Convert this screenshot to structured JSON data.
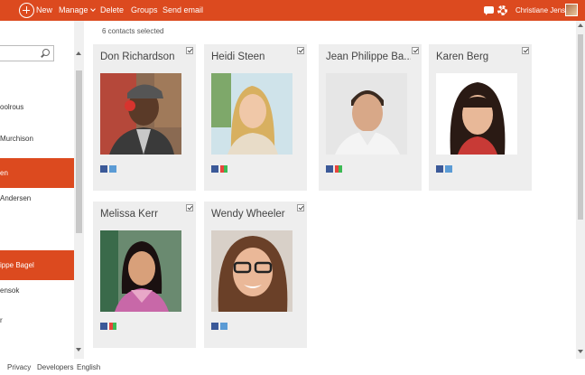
{
  "toolbar": {
    "new_label": "New",
    "manage_label": "Manage",
    "delete_label": "Delete",
    "groups_label": "Groups",
    "send_email_label": "Send email",
    "user_name": "Christiane Jensen",
    "accent_color": "#dc4a1f"
  },
  "sidebar": {
    "items": [
      {
        "label": "oolrous"
      },
      {
        "label": "Murchison"
      },
      {
        "label": "en",
        "selected": true
      },
      {
        "label": "Andersen"
      },
      {
        "label": "ippe Bagel",
        "selected": true
      },
      {
        "label": "ensok"
      },
      {
        "label": "r"
      }
    ]
  },
  "main": {
    "selected_count": "6 contacts selected",
    "cards": [
      {
        "name": "Don Richardson",
        "social": [
          "facebook",
          "linkedin"
        ]
      },
      {
        "name": "Heidi Steen",
        "social": [
          "facebook",
          "google"
        ]
      },
      {
        "name": "Jean Philippe Ba...",
        "social": [
          "facebook",
          "google"
        ]
      },
      {
        "name": "Karen Berg",
        "social": [
          "facebook",
          "linkedin"
        ]
      },
      {
        "name": "Melissa Kerr",
        "social": [
          "facebook",
          "google"
        ]
      },
      {
        "name": "Wendy Wheeler",
        "social": [
          "facebook",
          "linkedin"
        ]
      }
    ]
  },
  "footer": {
    "privacy": "Privacy",
    "developers": "Developers",
    "language": "English"
  }
}
